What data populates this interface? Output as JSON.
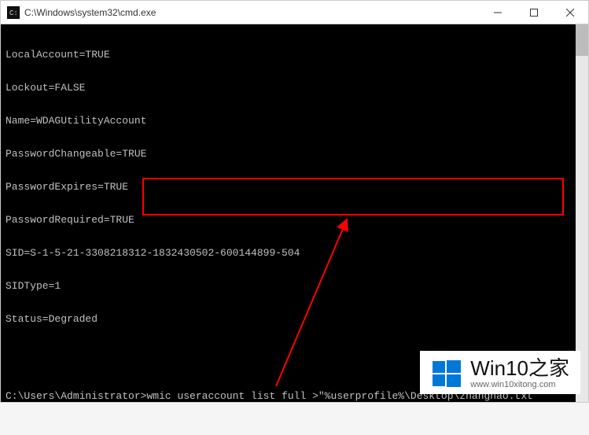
{
  "window": {
    "title": "C:\\Windows\\system32\\cmd.exe"
  },
  "output": {
    "lines": [
      "LocalAccount=TRUE",
      "Lockout=FALSE",
      "Name=WDAGUtilityAccount",
      "PasswordChangeable=TRUE",
      "PasswordExpires=TRUE",
      "PasswordRequired=TRUE",
      "SID=S-1-5-21-3308218312-1832430502-600144899-504",
      "SIDType=1",
      "Status=Degraded",
      "",
      ""
    ]
  },
  "prompt": {
    "path": "C:\\Users\\Administrator>",
    "command": "wmic useraccount list full >\"%userprofile%\\Desktop\\zhanghao.txt"
  },
  "watermark": {
    "title": "Win10之家",
    "url": "www.win10xitong.com"
  },
  "colors": {
    "highlight": "#ff0000",
    "arrow": "#ff0000",
    "brand": "#0078d7"
  }
}
